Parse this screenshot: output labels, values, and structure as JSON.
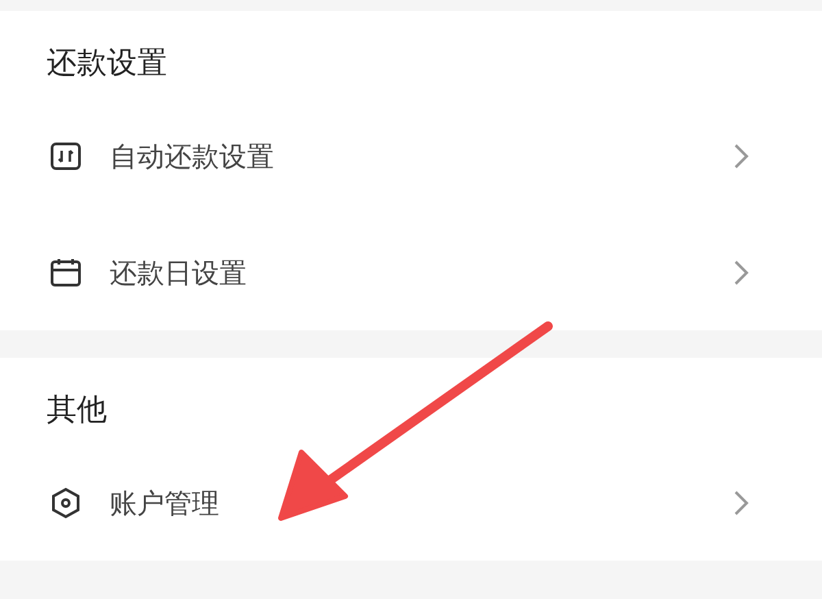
{
  "sections": [
    {
      "title": "还款设置",
      "items": [
        {
          "label": "自动还款设置",
          "kind": "transfer"
        },
        {
          "label": "还款日设置",
          "kind": "calendar"
        }
      ]
    },
    {
      "title": "其他",
      "items": [
        {
          "label": "账户管理",
          "kind": "hexagon"
        }
      ]
    }
  ]
}
